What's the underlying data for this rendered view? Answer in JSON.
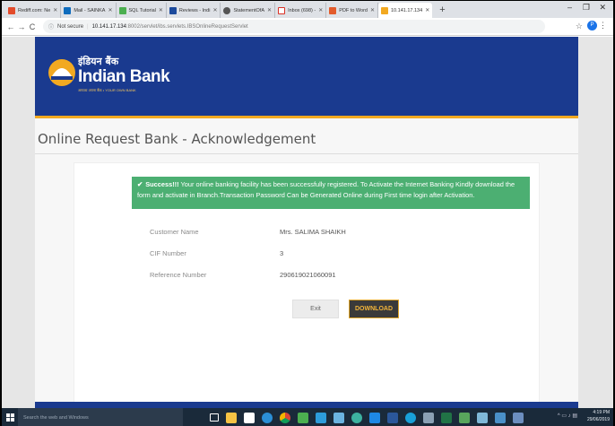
{
  "browser": {
    "tabs": [
      {
        "label": "Rediff.com: Ne",
        "color": "#e34b2b"
      },
      {
        "label": "Mail - SAINKA",
        "color": "#0f6cbd"
      },
      {
        "label": "SQL Tutorial",
        "color": "#4caf50"
      },
      {
        "label": "Reviews - Indi",
        "color": "#1c4a9c"
      },
      {
        "label": "StatementOfA",
        "color": "#555555"
      },
      {
        "label": "Inbox (698) -",
        "color": "#d93025"
      },
      {
        "label": "PDF to Word",
        "color": "#e35b2b"
      },
      {
        "label": "10.141.17.134",
        "color": "#f2a921",
        "active": true
      }
    ],
    "new_tab_label": "+",
    "window_controls": {
      "minimize": "–",
      "maximize": "❐",
      "close": "✕"
    },
    "nav": {
      "back": "←",
      "forward": "→",
      "reload": "C"
    },
    "address": {
      "security": "Not secure",
      "host": "10.141.17.134",
      "path": ":8002/servlet/ibs.servlets.IBSOnlineRequestServlet"
    },
    "profile_initial": "P"
  },
  "site": {
    "logo": {
      "hindi": "इंडियन बैंक",
      "english": "Indian Bank",
      "tagline": "आपका अपना बैंक • YOUR OWN BANK"
    },
    "page_title": "Online Request Bank - Acknowledgement",
    "alert": {
      "check": "✔",
      "strong": "Success!!!",
      "message": " Your online banking facility has been successfully registered. To Activate the Internet Banking Kindly download the form and activate in Branch.Transaction Password Can be Generated Online during First time login after Activation."
    },
    "details": [
      {
        "label": "Customer Name",
        "value": "Mrs. SALIMA SHAIKH"
      },
      {
        "label": "CIF Number",
        "value": "3"
      },
      {
        "label": "Reference Number",
        "value": "290619021060091"
      }
    ],
    "buttons": {
      "exit": "Exit",
      "download": "DOWNLOAD"
    }
  },
  "taskbar": {
    "search_placeholder": "Search the web and Windows",
    "clock_time": "4:19 PM",
    "clock_date": "29/06/2019"
  }
}
